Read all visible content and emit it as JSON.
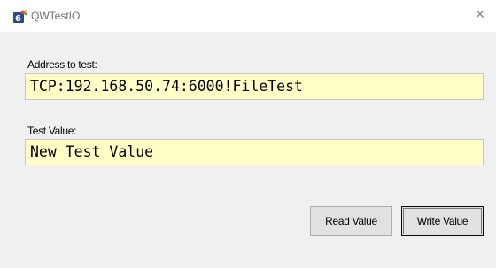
{
  "window": {
    "title": "QWTestIO",
    "close_glyph": "✕"
  },
  "form": {
    "address_label": "Address to test:",
    "address_value": "TCP:192.168.50.74:6000!FileTest",
    "value_label": "Test Value:",
    "value_value": "New Test Value"
  },
  "buttons": {
    "read_label": "Read Value",
    "write_label": "Write Value"
  },
  "colors": {
    "field_background": "#ffffc6",
    "window_background": "#f0f0f0",
    "titlebar_background": "#ffffff"
  },
  "icons": {
    "app": "app-icon",
    "close": "close-icon"
  }
}
